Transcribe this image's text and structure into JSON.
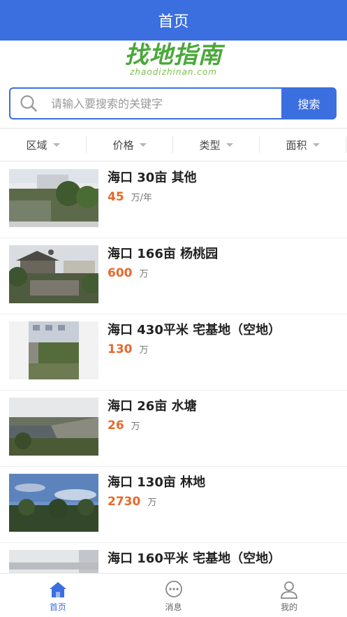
{
  "header": {
    "title": "首页"
  },
  "logo": {
    "main": "找地指南",
    "sub": "zhaodizhinan.com"
  },
  "search": {
    "placeholder": "请输入要搜索的关键字",
    "button_label": "搜索"
  },
  "filters": [
    {
      "label": "区域"
    },
    {
      "label": "价格"
    },
    {
      "label": "类型"
    },
    {
      "label": "面积"
    }
  ],
  "listings": [
    {
      "title": "海口 30亩 其他",
      "price": "45",
      "unit": "万/年"
    },
    {
      "title": "海口 166亩 杨桃园",
      "price": "600",
      "unit": "万"
    },
    {
      "title": "海口 430平米 宅基地（空地）",
      "price": "130",
      "unit": "万"
    },
    {
      "title": "海口 26亩 水塘",
      "price": "26",
      "unit": "万"
    },
    {
      "title": "海口 130亩 林地",
      "price": "2730",
      "unit": "万"
    },
    {
      "title": "海口 160平米 宅基地（空地）",
      "price": "",
      "unit": ""
    }
  ],
  "tabbar": [
    {
      "label": "首页",
      "icon": "home-icon",
      "active": true
    },
    {
      "label": "消息",
      "icon": "message-icon",
      "active": false
    },
    {
      "label": "我的",
      "icon": "profile-icon",
      "active": false
    }
  ],
  "colors": {
    "primary": "#3b6fe0",
    "price": "#e8692a",
    "logo": "#4aa83a"
  }
}
